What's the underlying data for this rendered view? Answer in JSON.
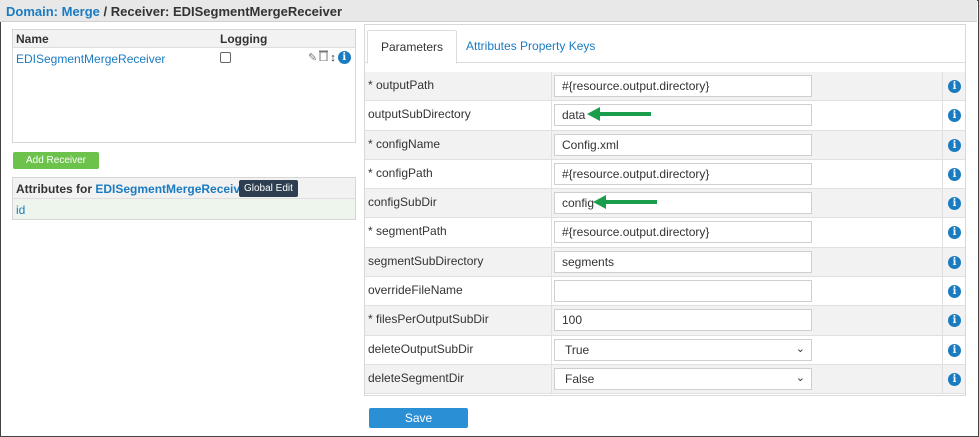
{
  "breadcrumb": {
    "domain_label": "Domain:",
    "domain_value": "Merge",
    "separator": "/",
    "receiver_label": "Receiver:",
    "receiver_value": "EDISegmentMergeReceiver"
  },
  "receivers_table": {
    "col_name": "Name",
    "col_logging": "Logging",
    "rows": [
      {
        "name": "EDISegmentMergeReceiver",
        "logging": false
      }
    ]
  },
  "add_receiver_label": "Add Receiver",
  "attributes": {
    "label": "Attributes for",
    "receiver": "EDISegmentMergeReceiver",
    "global_edit_label": "Global Edit",
    "rows": [
      "id"
    ]
  },
  "tabs": [
    {
      "label": "Parameters",
      "active": true
    },
    {
      "label": "Attributes Property Keys",
      "active": false
    }
  ],
  "params": [
    {
      "label": "* outputPath",
      "value": "#{resource.output.directory}",
      "type": "text"
    },
    {
      "label": "outputSubDirectory",
      "value": "data",
      "type": "text",
      "arrow": true
    },
    {
      "label": "* configName",
      "value": "Config.xml",
      "type": "text"
    },
    {
      "label": "* configPath",
      "value": "#{resource.output.directory}",
      "type": "text"
    },
    {
      "label": "configSubDir",
      "value": "config",
      "type": "text",
      "arrow": true
    },
    {
      "label": "* segmentPath",
      "value": "#{resource.output.directory}",
      "type": "text"
    },
    {
      "label": "segmentSubDirectory",
      "value": "segments",
      "type": "text"
    },
    {
      "label": "overrideFileName",
      "value": "",
      "type": "text"
    },
    {
      "label": "* filesPerOutputSubDir",
      "value": "100",
      "type": "text"
    },
    {
      "label": "deleteOutputSubDir",
      "value": "True",
      "type": "select"
    },
    {
      "label": "deleteSegmentDir",
      "value": "False",
      "type": "select"
    }
  ],
  "save_label": "Save",
  "colors": {
    "link": "#1a7bc1",
    "arrow": "#1a9e4b",
    "add_button": "#6cc24a",
    "save_button": "#2b8fd6",
    "global_edit": "#2c3e50"
  },
  "icons": {
    "info": "i",
    "edit": "✎",
    "delete": "🗑",
    "reorder": "↕",
    "chevron": "⌄"
  }
}
